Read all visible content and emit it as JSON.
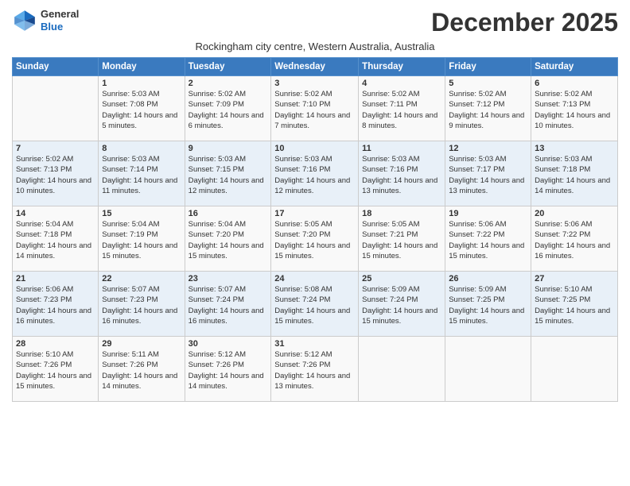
{
  "logo": {
    "line1": "General",
    "line2": "Blue"
  },
  "title": "December 2025",
  "subtitle": "Rockingham city centre, Western Australia, Australia",
  "days_of_week": [
    "Sunday",
    "Monday",
    "Tuesday",
    "Wednesday",
    "Thursday",
    "Friday",
    "Saturday"
  ],
  "weeks": [
    [
      {
        "day": "",
        "sunrise": "",
        "sunset": "",
        "daylight": ""
      },
      {
        "day": "1",
        "sunrise": "Sunrise: 5:03 AM",
        "sunset": "Sunset: 7:08 PM",
        "daylight": "Daylight: 14 hours and 5 minutes."
      },
      {
        "day": "2",
        "sunrise": "Sunrise: 5:02 AM",
        "sunset": "Sunset: 7:09 PM",
        "daylight": "Daylight: 14 hours and 6 minutes."
      },
      {
        "day": "3",
        "sunrise": "Sunrise: 5:02 AM",
        "sunset": "Sunset: 7:10 PM",
        "daylight": "Daylight: 14 hours and 7 minutes."
      },
      {
        "day": "4",
        "sunrise": "Sunrise: 5:02 AM",
        "sunset": "Sunset: 7:11 PM",
        "daylight": "Daylight: 14 hours and 8 minutes."
      },
      {
        "day": "5",
        "sunrise": "Sunrise: 5:02 AM",
        "sunset": "Sunset: 7:12 PM",
        "daylight": "Daylight: 14 hours and 9 minutes."
      },
      {
        "day": "6",
        "sunrise": "Sunrise: 5:02 AM",
        "sunset": "Sunset: 7:13 PM",
        "daylight": "Daylight: 14 hours and 10 minutes."
      }
    ],
    [
      {
        "day": "7",
        "sunrise": "Sunrise: 5:02 AM",
        "sunset": "Sunset: 7:13 PM",
        "daylight": "Daylight: 14 hours and 10 minutes."
      },
      {
        "day": "8",
        "sunrise": "Sunrise: 5:03 AM",
        "sunset": "Sunset: 7:14 PM",
        "daylight": "Daylight: 14 hours and 11 minutes."
      },
      {
        "day": "9",
        "sunrise": "Sunrise: 5:03 AM",
        "sunset": "Sunset: 7:15 PM",
        "daylight": "Daylight: 14 hours and 12 minutes."
      },
      {
        "day": "10",
        "sunrise": "Sunrise: 5:03 AM",
        "sunset": "Sunset: 7:16 PM",
        "daylight": "Daylight: 14 hours and 12 minutes."
      },
      {
        "day": "11",
        "sunrise": "Sunrise: 5:03 AM",
        "sunset": "Sunset: 7:16 PM",
        "daylight": "Daylight: 14 hours and 13 minutes."
      },
      {
        "day": "12",
        "sunrise": "Sunrise: 5:03 AM",
        "sunset": "Sunset: 7:17 PM",
        "daylight": "Daylight: 14 hours and 13 minutes."
      },
      {
        "day": "13",
        "sunrise": "Sunrise: 5:03 AM",
        "sunset": "Sunset: 7:18 PM",
        "daylight": "Daylight: 14 hours and 14 minutes."
      }
    ],
    [
      {
        "day": "14",
        "sunrise": "Sunrise: 5:04 AM",
        "sunset": "Sunset: 7:18 PM",
        "daylight": "Daylight: 14 hours and 14 minutes."
      },
      {
        "day": "15",
        "sunrise": "Sunrise: 5:04 AM",
        "sunset": "Sunset: 7:19 PM",
        "daylight": "Daylight: 14 hours and 15 minutes."
      },
      {
        "day": "16",
        "sunrise": "Sunrise: 5:04 AM",
        "sunset": "Sunset: 7:20 PM",
        "daylight": "Daylight: 14 hours and 15 minutes."
      },
      {
        "day": "17",
        "sunrise": "Sunrise: 5:05 AM",
        "sunset": "Sunset: 7:20 PM",
        "daylight": "Daylight: 14 hours and 15 minutes."
      },
      {
        "day": "18",
        "sunrise": "Sunrise: 5:05 AM",
        "sunset": "Sunset: 7:21 PM",
        "daylight": "Daylight: 14 hours and 15 minutes."
      },
      {
        "day": "19",
        "sunrise": "Sunrise: 5:06 AM",
        "sunset": "Sunset: 7:22 PM",
        "daylight": "Daylight: 14 hours and 15 minutes."
      },
      {
        "day": "20",
        "sunrise": "Sunrise: 5:06 AM",
        "sunset": "Sunset: 7:22 PM",
        "daylight": "Daylight: 14 hours and 16 minutes."
      }
    ],
    [
      {
        "day": "21",
        "sunrise": "Sunrise: 5:06 AM",
        "sunset": "Sunset: 7:23 PM",
        "daylight": "Daylight: 14 hours and 16 minutes."
      },
      {
        "day": "22",
        "sunrise": "Sunrise: 5:07 AM",
        "sunset": "Sunset: 7:23 PM",
        "daylight": "Daylight: 14 hours and 16 minutes."
      },
      {
        "day": "23",
        "sunrise": "Sunrise: 5:07 AM",
        "sunset": "Sunset: 7:24 PM",
        "daylight": "Daylight: 14 hours and 16 minutes."
      },
      {
        "day": "24",
        "sunrise": "Sunrise: 5:08 AM",
        "sunset": "Sunset: 7:24 PM",
        "daylight": "Daylight: 14 hours and 15 minutes."
      },
      {
        "day": "25",
        "sunrise": "Sunrise: 5:09 AM",
        "sunset": "Sunset: 7:24 PM",
        "daylight": "Daylight: 14 hours and 15 minutes."
      },
      {
        "day": "26",
        "sunrise": "Sunrise: 5:09 AM",
        "sunset": "Sunset: 7:25 PM",
        "daylight": "Daylight: 14 hours and 15 minutes."
      },
      {
        "day": "27",
        "sunrise": "Sunrise: 5:10 AM",
        "sunset": "Sunset: 7:25 PM",
        "daylight": "Daylight: 14 hours and 15 minutes."
      }
    ],
    [
      {
        "day": "28",
        "sunrise": "Sunrise: 5:10 AM",
        "sunset": "Sunset: 7:26 PM",
        "daylight": "Daylight: 14 hours and 15 minutes."
      },
      {
        "day": "29",
        "sunrise": "Sunrise: 5:11 AM",
        "sunset": "Sunset: 7:26 PM",
        "daylight": "Daylight: 14 hours and 14 minutes."
      },
      {
        "day": "30",
        "sunrise": "Sunrise: 5:12 AM",
        "sunset": "Sunset: 7:26 PM",
        "daylight": "Daylight: 14 hours and 14 minutes."
      },
      {
        "day": "31",
        "sunrise": "Sunrise: 5:12 AM",
        "sunset": "Sunset: 7:26 PM",
        "daylight": "Daylight: 14 hours and 13 minutes."
      },
      {
        "day": "",
        "sunrise": "",
        "sunset": "",
        "daylight": ""
      },
      {
        "day": "",
        "sunrise": "",
        "sunset": "",
        "daylight": ""
      },
      {
        "day": "",
        "sunrise": "",
        "sunset": "",
        "daylight": ""
      }
    ]
  ]
}
